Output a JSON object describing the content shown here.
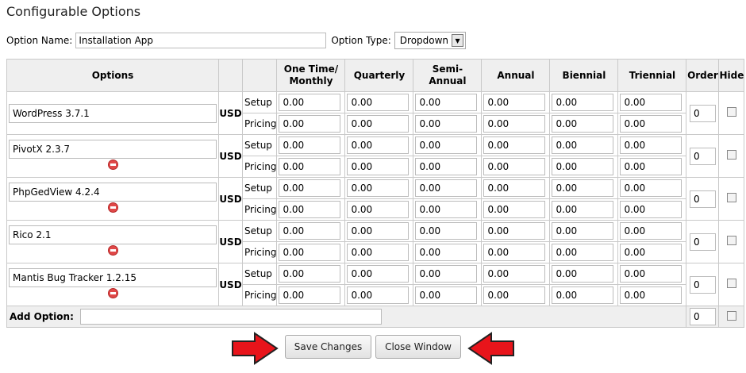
{
  "page": {
    "title": "Configurable Options",
    "option_name_label": "Option Name:",
    "option_name_value": "Installation App",
    "option_type_label": "Option Type:",
    "option_type_value": "Dropdown"
  },
  "table": {
    "headers": {
      "options": "Options",
      "one_time_line1": "One Time/",
      "one_time_line2": "Monthly",
      "quarterly": "Quarterly",
      "semi_annual": "Semi-Annual",
      "annual": "Annual",
      "biennial": "Biennial",
      "triennial": "Triennial",
      "order": "Order",
      "hide": "Hide"
    },
    "currency": "USD",
    "setup_label": "Setup",
    "pricing_label": "Pricing",
    "rows": [
      {
        "name": "WordPress 3.7.1",
        "setup": [
          "0.00",
          "0.00",
          "0.00",
          "0.00",
          "0.00",
          "0.00"
        ],
        "pricing": [
          "0.00",
          "0.00",
          "0.00",
          "0.00",
          "0.00",
          "0.00"
        ],
        "order": "0",
        "has_delete": false
      },
      {
        "name": "PivotX 2.3.7",
        "setup": [
          "0.00",
          "0.00",
          "0.00",
          "0.00",
          "0.00",
          "0.00"
        ],
        "pricing": [
          "0.00",
          "0.00",
          "0.00",
          "0.00",
          "0.00",
          "0.00"
        ],
        "order": "0",
        "has_delete": true
      },
      {
        "name": "PhpGedView 4.2.4",
        "setup": [
          "0.00",
          "0.00",
          "0.00",
          "0.00",
          "0.00",
          "0.00"
        ],
        "pricing": [
          "0.00",
          "0.00",
          "0.00",
          "0.00",
          "0.00",
          "0.00"
        ],
        "order": "0",
        "has_delete": true
      },
      {
        "name": "Rico 2.1",
        "setup": [
          "0.00",
          "0.00",
          "0.00",
          "0.00",
          "0.00",
          "0.00"
        ],
        "pricing": [
          "0.00",
          "0.00",
          "0.00",
          "0.00",
          "0.00",
          "0.00"
        ],
        "order": "0",
        "has_delete": true
      },
      {
        "name": "Mantis Bug Tracker 1.2.15",
        "setup": [
          "0.00",
          "0.00",
          "0.00",
          "0.00",
          "0.00",
          "0.00"
        ],
        "pricing": [
          "0.00",
          "0.00",
          "0.00",
          "0.00",
          "0.00",
          "0.00"
        ],
        "order": "0",
        "has_delete": true
      }
    ],
    "add_option_label": "Add Option:",
    "add_option_value": "",
    "add_order": "0"
  },
  "buttons": {
    "save": "Save Changes",
    "close": "Close Window"
  },
  "colors": {
    "header_bg": "#efefef",
    "arrow_red": "#e8141b",
    "delete_red": "#e04848"
  }
}
